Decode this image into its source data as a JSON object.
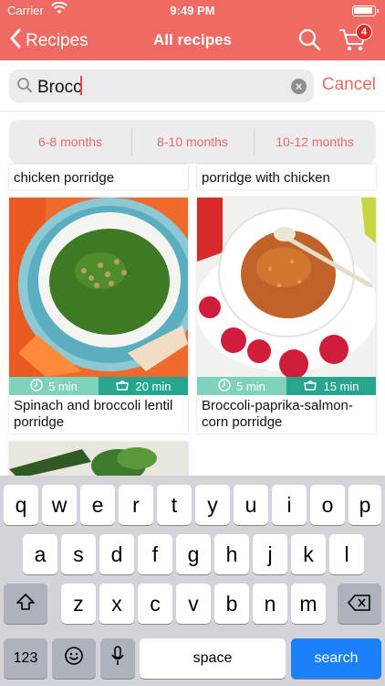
{
  "status": {
    "carrier": "Carrier",
    "time": "9:49 PM",
    "battery_level": 0.95
  },
  "nav": {
    "back_label": "Recipes",
    "title": "All recipes",
    "cart_count": "4"
  },
  "search": {
    "value": "Brocc",
    "cancel_label": "Cancel"
  },
  "age_tabs": [
    "6-8 months",
    "8-10 months",
    "10-12 months"
  ],
  "recipes": [
    {
      "title": "chicken porridge"
    },
    {
      "title": "porridge with chicken"
    },
    {
      "title": "Spinach and broccoli lentil porridge",
      "prep_time": "5 min",
      "cook_time": "20 min"
    },
    {
      "title": "Broccoli-paprika-salmon-corn porridge",
      "prep_time": "5 min",
      "cook_time": "15 min"
    }
  ],
  "keyboard": {
    "row1": [
      "q",
      "w",
      "e",
      "r",
      "t",
      "y",
      "u",
      "i",
      "o",
      "p"
    ],
    "row2": [
      "a",
      "s",
      "d",
      "f",
      "g",
      "h",
      "j",
      "k",
      "l"
    ],
    "row3": [
      "z",
      "x",
      "c",
      "v",
      "b",
      "n",
      "m"
    ],
    "numbers_label": "123",
    "space_label": "space",
    "search_label": "search"
  },
  "colors": {
    "brand": "#ee6a62",
    "prep_bar": "#7fd3bd",
    "cook_bar": "#27a58e",
    "badge": "#e82623",
    "search_key": "#1a80fb"
  },
  "icons": [
    "chevron-left-icon",
    "magnifier-icon",
    "cart-icon",
    "clock-icon",
    "pot-icon",
    "clear-icon",
    "shift-icon",
    "backspace-icon",
    "emoji-icon",
    "microphone-icon",
    "wifi-icon",
    "battery-icon"
  ]
}
